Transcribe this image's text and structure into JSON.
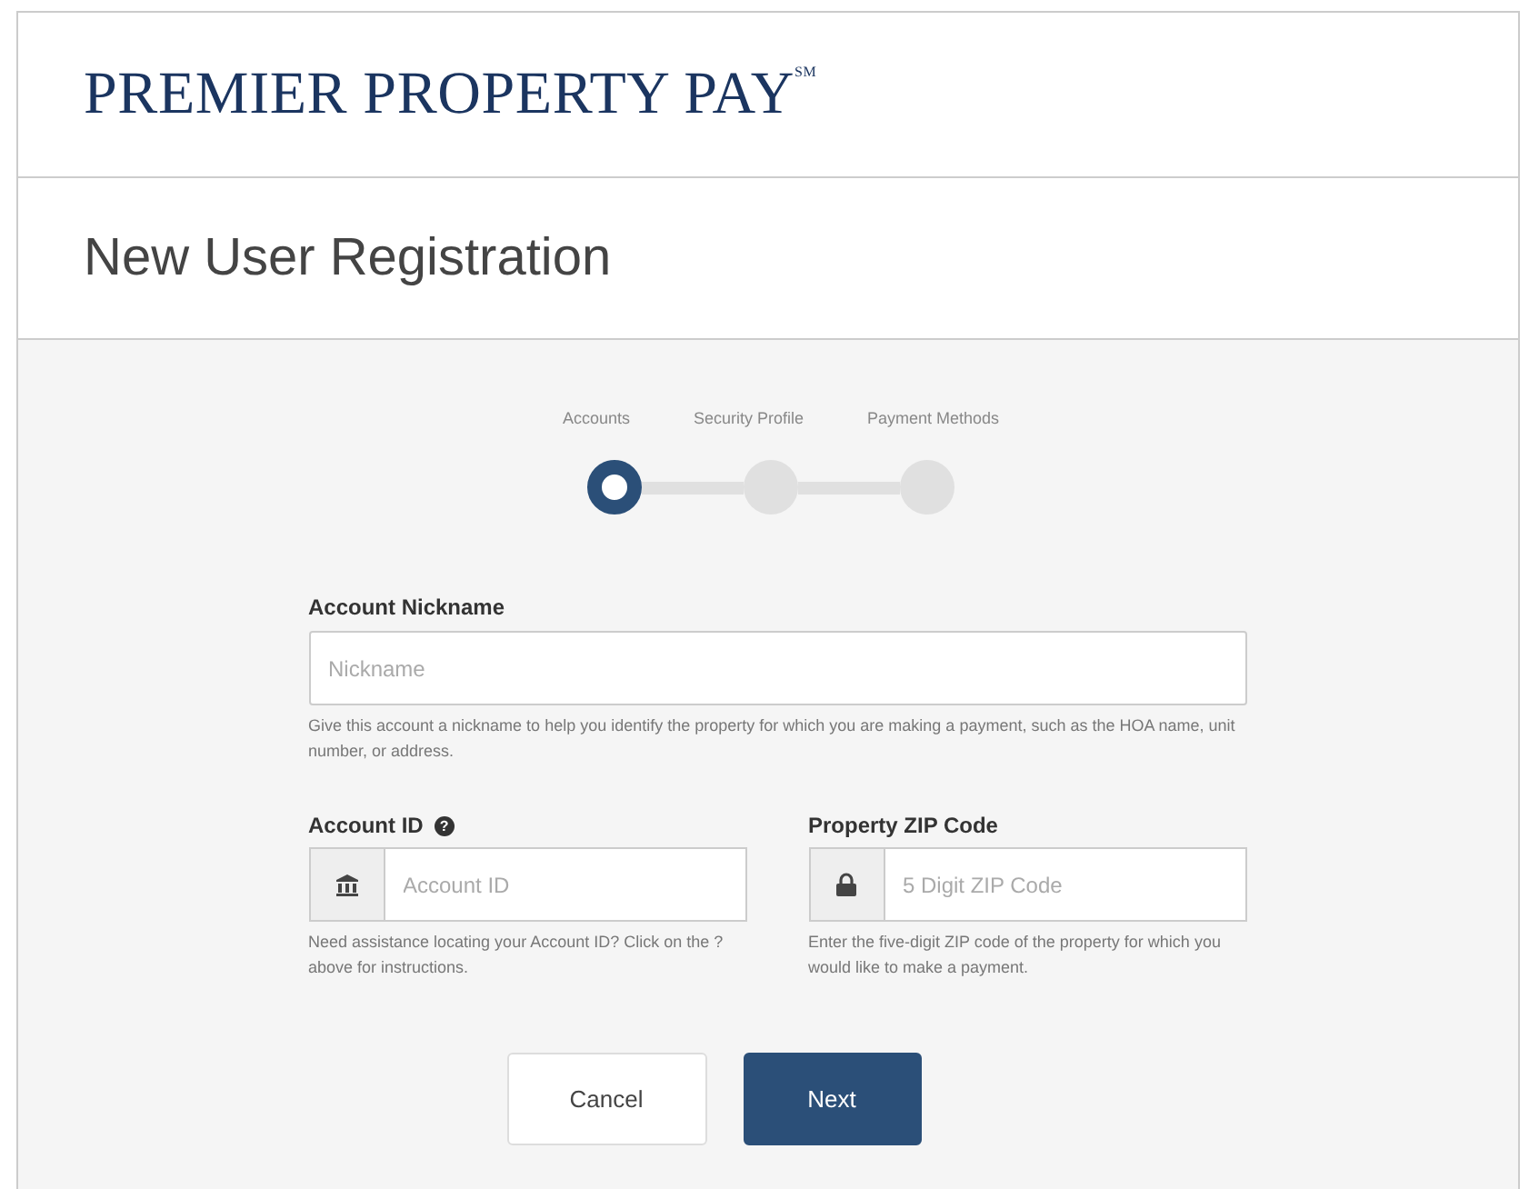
{
  "logo": "PREMIER PROPERTY PAY$^{SM}$",
  "page_title": "New User Registration",
  "steps": [
    {
      "label": "Accounts",
      "current": true
    },
    {
      "label": "Security Profile",
      "current": false
    },
    {
      "label": "Payment Methods",
      "current": false
    }
  ],
  "nickname": {
    "label": "Account Nickname",
    "placeholder": "Nickname",
    "help": "Give this account a nickname to help you identify the property for which you are making a payment, such as the HOA name, unit number, or address."
  },
  "account_id": {
    "label": "Account ID",
    "help_icon": "?",
    "placeholder": "Account ID",
    "help": "Need assistance locating your Account ID? Click on the ? above for instructions."
  },
  "zip": {
    "label": "Property ZIP Code",
    "placeholder": "5 Digit ZIP Code",
    "help": "Enter the five-digit ZIP code of the property for which you would like to make a payment."
  },
  "buttons": [
    {
      "label": "Cancel",
      "kind": "secondary"
    },
    {
      "label": "Next",
      "kind": "primary"
    }
  ]
}
